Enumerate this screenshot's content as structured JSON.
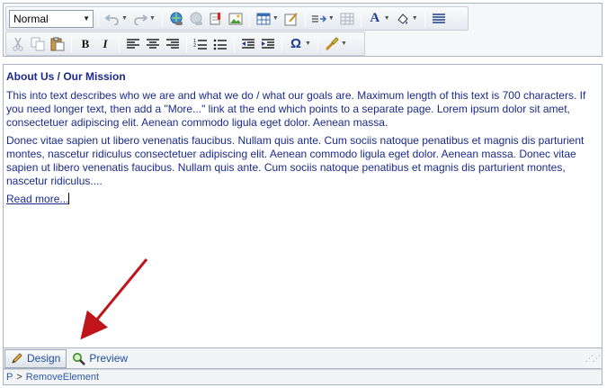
{
  "toolbar": {
    "format_value": "Normal",
    "row1": [
      "undo-icon",
      "redo-icon",
      "insert-link-icon",
      "remove-link-icon",
      "insert-anchor-icon",
      "insert-image-icon",
      "insert-table-icon",
      "edit-form-icon",
      "insert-snippet-icon",
      "grid-icon",
      "text-color-icon",
      "highlight-color-icon",
      "align-justify-icon"
    ],
    "row2": [
      "cut-icon",
      "copy-icon",
      "paste-icon",
      "bold-icon",
      "italic-icon",
      "align-left-icon",
      "align-center-icon",
      "align-right-icon",
      "numbered-list-icon",
      "bulleted-list-icon",
      "outdent-icon",
      "indent-icon",
      "special-char-icon",
      "format-stripper-icon"
    ],
    "bold_label": "B",
    "italic_label": "I",
    "text_color_label": "A",
    "special_char_label": "Ω"
  },
  "editor": {
    "heading": "About Us / Our Mission",
    "paragraph1": "This into text describes who we are and what we do / what our goals are. Maximum length of this text is 700 characters. If you need longer text, then add a \"More...\" link at the end which points to a separate page. Lorem ipsum dolor sit amet, consectetuer adipiscing elit. Aenean commodo ligula eget dolor. Aenean massa.",
    "paragraph2": "Donec vitae sapien ut libero venenatis faucibus. Nullam quis ante. Cum sociis natoque penatibus et magnis dis parturient montes, nascetur ridiculus consectetuer adipiscing elit. Aenean commodo ligula eget dolor. Aenean massa. Donec vitae sapien ut libero venenatis faucibus. Nullam quis ante. Cum sociis natoque penatibus et magnis dis parturient montes, nascetur ridiculus....",
    "read_more": "Read more..."
  },
  "modes": {
    "design_label": "Design",
    "preview_label": "Preview"
  },
  "status": {
    "path_root": "P",
    "separator": ">",
    "path_item": "RemoveElement"
  },
  "colors": {
    "editor_text": "#1b2a8c",
    "annotation_arrow": "#c0141b",
    "link_blue": "#2e5aa8"
  }
}
